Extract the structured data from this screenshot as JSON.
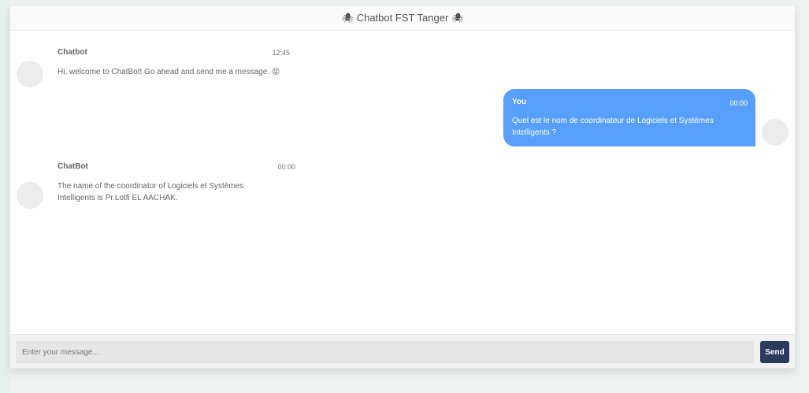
{
  "header": {
    "title": "Chatbot FST Tanger",
    "icon_left": "🕷",
    "icon_right": "🕷"
  },
  "messages": [
    {
      "side": "left",
      "name": "Chatbot",
      "time": "12:45",
      "text": "Hi, welcome to ChatBot! Go ahead and send me a message. 😜"
    },
    {
      "side": "right",
      "name": "You",
      "time": "00:00",
      "text": "Quel est le nom de coordinateur de Logiciels et Systèmes Intelligents ?"
    },
    {
      "side": "left",
      "name": "ChatBot",
      "time": "00:00",
      "text": "The name of the coordinator of Logiciels et Systèmes Intelligents is Pr.Lotfi EL AACHAK."
    }
  ],
  "input": {
    "placeholder": "Enter your message...",
    "value": ""
  },
  "send_button": {
    "label": "Send"
  },
  "colors": {
    "user_bubble": "#579ffb",
    "send_button": "#2e3a5c"
  }
}
